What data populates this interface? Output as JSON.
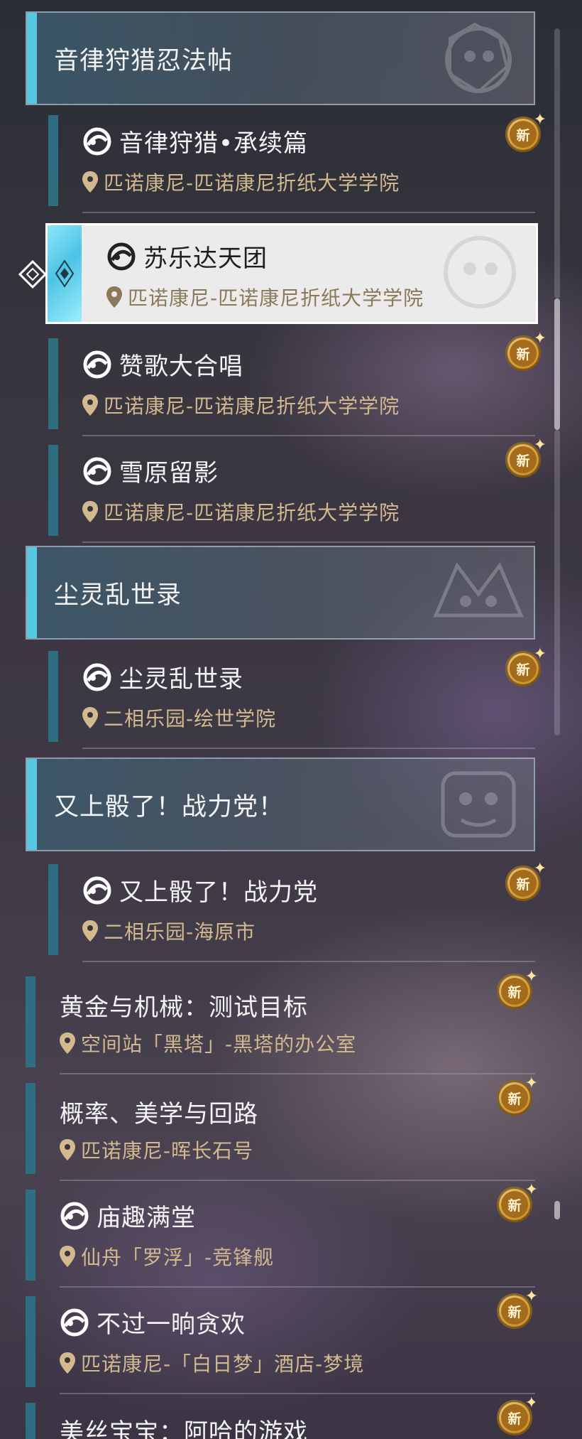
{
  "badge_label": "新",
  "colors": {
    "accent": "#56c8e4",
    "location_text": "#d2b98e",
    "badge": "#c98f2c"
  },
  "groups": [
    {
      "title": "音律狩猎忍法帖"
    },
    {
      "title": "尘灵乱世录"
    },
    {
      "title": "又上骰了！战力党！"
    }
  ],
  "quests": [
    {
      "title": "音律狩猎•承续篇",
      "location": "匹诺康尼-匹诺康尼折纸大学学院",
      "icon": "quest-icon",
      "is_new": true
    },
    {
      "title": "苏乐达天团",
      "location": "匹诺康尼-匹诺康尼折纸大学学院",
      "icon": "quest-icon",
      "selected": true
    },
    {
      "title": "赞歌大合唱",
      "location": "匹诺康尼-匹诺康尼折纸大学学院",
      "icon": "quest-icon",
      "is_new": true
    },
    {
      "title": "雪原留影",
      "location": "匹诺康尼-匹诺康尼折纸大学学院",
      "icon": "quest-icon",
      "is_new": true
    },
    {
      "title": "尘灵乱世录",
      "location": "二相乐园-绘世学院",
      "icon": "quest-icon",
      "is_new": true
    },
    {
      "title": "又上骰了！战力党",
      "location": "二相乐园-海原市",
      "icon": "quest-icon",
      "is_new": true
    },
    {
      "title": "黄金与机械：测试目标",
      "location": "空间站「黑塔」-黑塔的办公室",
      "is_new": true
    },
    {
      "title": "概率、美学与回路",
      "location": "匹诺康尼-晖长石号",
      "is_new": true
    },
    {
      "title": "庙趣满堂",
      "location": "仙舟「罗浮」-竞锋舰",
      "icon": "quest-icon",
      "is_new": true
    },
    {
      "title": "不过一晌贪欢",
      "location": "匹诺康尼-「白日梦」酒店-梦境",
      "icon": "quest-icon",
      "is_new": true
    },
    {
      "title": "美丝宝宝：阿哈的游戏",
      "location": "",
      "is_new": true
    }
  ]
}
